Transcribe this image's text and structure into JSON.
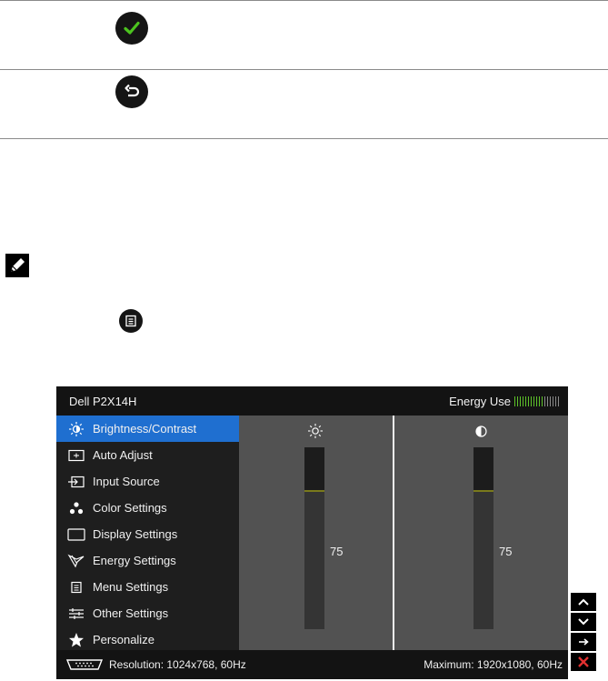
{
  "icons": {
    "check": "checkmark-icon",
    "back": "back-arrow-icon",
    "note": "pencil-note-icon",
    "menu": "menu-icon"
  },
  "colors": {
    "check_green": "#4cc41f",
    "menu_highlight": "#1f6fd0",
    "energy_green": "#5ec22a",
    "exit_red": "#e03030"
  },
  "osd": {
    "model": "Dell P2X14H",
    "energy_label": "Energy Use",
    "energy_level": {
      "on": 11,
      "off": 6
    },
    "menu_items": [
      {
        "label": "Brightness/Contrast",
        "icon": "brightness-icon",
        "active": true
      },
      {
        "label": "Auto Adjust",
        "icon": "auto-adjust-icon",
        "active": false
      },
      {
        "label": "Input Source",
        "icon": "input-source-icon",
        "active": false
      },
      {
        "label": "Color Settings",
        "icon": "color-settings-icon",
        "active": false
      },
      {
        "label": "Display Settings",
        "icon": "display-settings-icon",
        "active": false
      },
      {
        "label": "Energy Settings",
        "icon": "energy-settings-icon",
        "active": false
      },
      {
        "label": "Menu Settings",
        "icon": "menu-settings-icon",
        "active": false
      },
      {
        "label": "Other Settings",
        "icon": "other-settings-icon",
        "active": false
      },
      {
        "label": "Personalize",
        "icon": "star-icon",
        "active": false
      }
    ],
    "brightness": {
      "value": "75",
      "level": 0.75,
      "icon": "sun-icon"
    },
    "contrast": {
      "value": "75",
      "level": 0.75,
      "icon": "contrast-icon"
    },
    "footer": {
      "resolution": "Resolution: 1024x768, 60Hz",
      "maximum": "Maximum: 1920x1080, 60Hz",
      "icon": "vga-connector-icon"
    }
  },
  "nav_buttons": [
    "up-arrow-icon",
    "down-arrow-icon",
    "right-arrow-icon",
    "exit-icon"
  ]
}
